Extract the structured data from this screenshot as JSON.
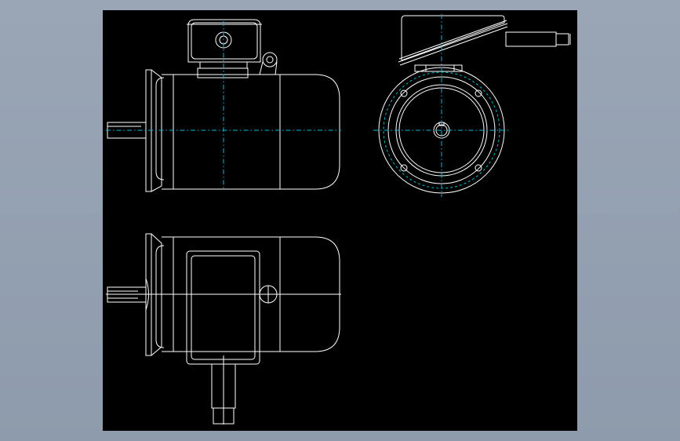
{
  "colors": {
    "background": "#97a3b4",
    "canvas": "#000000",
    "line": "#ffffff",
    "centerline": "#00bcd4"
  },
  "drawing": {
    "views": [
      "front-view",
      "end-view",
      "top-view"
    ]
  }
}
